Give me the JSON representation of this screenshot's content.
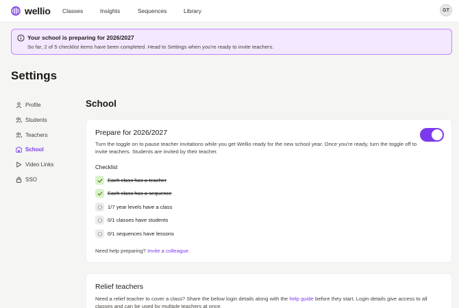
{
  "app": {
    "brand": "wellio"
  },
  "nav": [
    {
      "label": "Classes"
    },
    {
      "label": "Insights"
    },
    {
      "label": "Sequences"
    },
    {
      "label": "Library"
    }
  ],
  "user": {
    "initials": "GT"
  },
  "banner": {
    "title": "Your school is preparing for 2026/2027",
    "body": "So far, 2 of 5 checklist items have been completed. Head to Settings when you're ready to invite teachers.",
    "completed": 2,
    "total": 5
  },
  "page": {
    "title": "Settings"
  },
  "sidebar": {
    "items": [
      {
        "label": "Profile",
        "icon": "user-icon"
      },
      {
        "label": "Students",
        "icon": "users-icon"
      },
      {
        "label": "Teachers",
        "icon": "teachers-icon"
      },
      {
        "label": "School",
        "icon": "school-icon",
        "active": true
      },
      {
        "label": "Video Links",
        "icon": "play-icon"
      },
      {
        "label": "SSO",
        "icon": "lock-icon"
      }
    ]
  },
  "section": {
    "title": "School"
  },
  "prepare": {
    "title": "Prepare for 2026/2027",
    "description": "Turn the toggle on to pause teacher invitations while you get Wellio ready for the new school year. Once you're ready, turn the toggle off to invite teachers. Students are invited by their teacher.",
    "toggle_on": true,
    "checklist_label": "Checklist",
    "checklist": [
      {
        "text": "Each class has a teacher",
        "done": true
      },
      {
        "text": "Each class has a sequence",
        "done": true
      },
      {
        "text": "1/7 year levels have a class",
        "done": false
      },
      {
        "text": "0/1 classes have students",
        "done": false
      },
      {
        "text": "0/1 sequences have lessons",
        "done": false
      }
    ],
    "help_prefix": "Need help preparing?",
    "help_link": "Invite a colleague."
  },
  "relief": {
    "title": "Relief teachers",
    "desc_prefix": "Need a relief teacher to cover a class? Share the below login details along with the",
    "desc_link": "help guide",
    "desc_suffix": "before they start. Login details give access to all classes and can be used by multiple teachers at once."
  },
  "colors": {
    "accent": "#7c3aed",
    "banner_bg": "#f3e8ff",
    "banner_border": "#c084fc",
    "check_done_bg": "#d9f2c9",
    "check_done_mark": "#4d7c0f"
  }
}
